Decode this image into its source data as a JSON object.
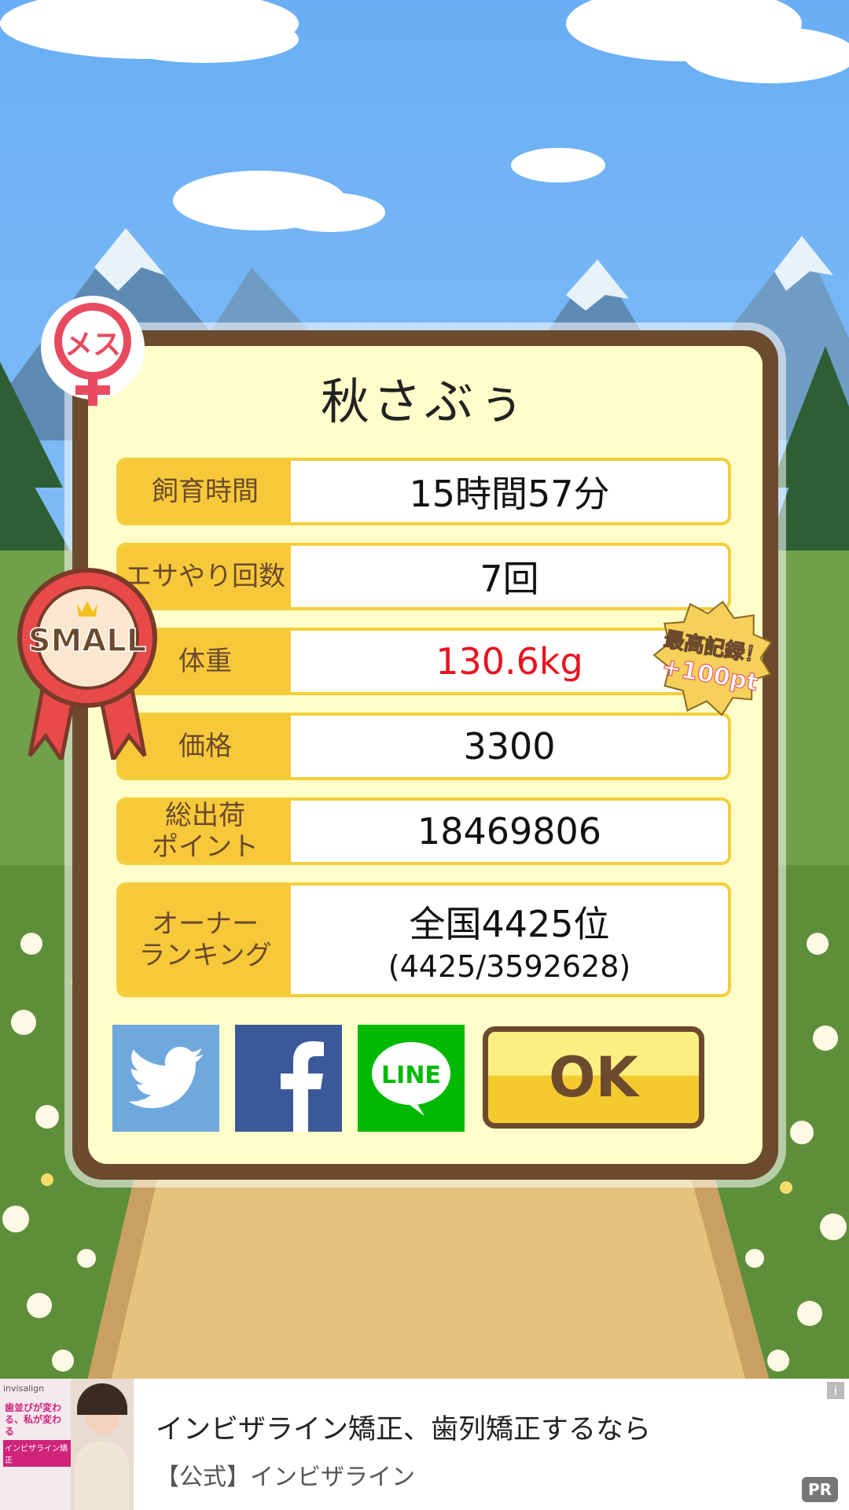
{
  "pig": {
    "name": "秋さぶぅ",
    "gender_symbol": "メス",
    "size_badge": "SMALL"
  },
  "record_badge": {
    "line1": "最高記録！",
    "line2": "+100pt"
  },
  "stats": [
    {
      "label": "飼育時間",
      "value": "15時間57分",
      "sub": ""
    },
    {
      "label": "エサやり回数",
      "value": "7回",
      "sub": ""
    },
    {
      "label": "体重",
      "value": "130.6kg",
      "sub": ""
    },
    {
      "label": "価格",
      "value": "3300",
      "sub": ""
    },
    {
      "label": "総出荷\nポイント",
      "value": "18469806",
      "sub": ""
    },
    {
      "label": "オーナー\nランキング",
      "value": "全国4425位",
      "sub": "(4425/3592628)"
    }
  ],
  "share": {
    "twitter_icon": "twitter-icon",
    "facebook_icon": "facebook-icon",
    "line_label": "LINE"
  },
  "ok_button": "OK",
  "ad": {
    "image_text_1": "invisalign",
    "image_text_2": "歯並びが変わる、私が変わる",
    "image_text_3": "インビザライン矯正",
    "title": "インビザライン矯正、歯列矯正するなら",
    "subtitle": "【公式】インビザライン",
    "pr_label": "PR",
    "info_label": "i"
  },
  "colors": {
    "panel_border": "#6b4a2e",
    "panel_fill": "#fffdc9",
    "label_fill": "#f7c93a",
    "highlight": "#e8121e",
    "twitter": "#6ea8dd",
    "facebook": "#3b5998",
    "line": "#00b900"
  }
}
